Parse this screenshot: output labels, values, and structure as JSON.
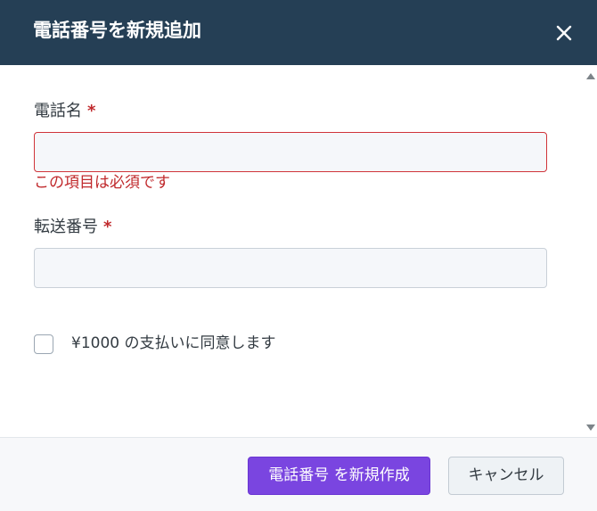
{
  "dialog": {
    "title": "電話番号を新規追加",
    "close_icon": "close-icon"
  },
  "form": {
    "phone_name": {
      "label": "電話名",
      "required_mark": "*",
      "value": "",
      "error": "この項目は必須です"
    },
    "forward_number": {
      "label": "転送番号",
      "required_mark": "*",
      "value": ""
    },
    "agree": {
      "label": "¥1000 の支払いに同意します",
      "checked": false
    }
  },
  "footer": {
    "create_label": "電話番号 を新規作成",
    "cancel_label": "キャンセル"
  },
  "colors": {
    "header_bg": "#253f55",
    "primary": "#7a45e0",
    "error": "#c0292c"
  }
}
